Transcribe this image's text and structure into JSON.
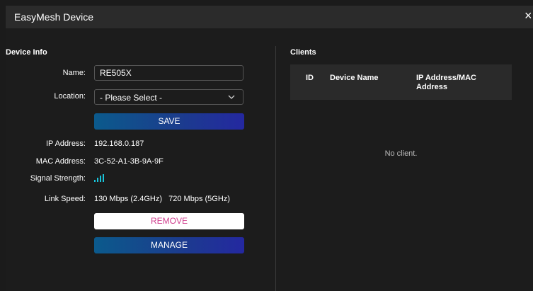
{
  "window": {
    "title": "EasyMesh Device",
    "close_glyph": "×"
  },
  "device_info": {
    "section_title": "Device Info",
    "name_label": "Name:",
    "name_value": "RE505X",
    "location_label": "Location:",
    "location_value": "- Please Select -",
    "save_label": "SAVE",
    "ip_label": "IP Address:",
    "ip_value": "192.168.0.187",
    "mac_label": "MAC Address:",
    "mac_value": "3C-52-A1-3B-9A-9F",
    "signal_label": "Signal Strength:",
    "signal_icon": "signal-bars-icon",
    "signal_bars": 4,
    "link_label": "Link Speed:",
    "link_value": "130 Mbps (2.4GHz)   720 Mbps (5GHz)",
    "remove_label": "REMOVE",
    "manage_label": "MANAGE"
  },
  "clients": {
    "section_title": "Clients",
    "columns": [
      "ID",
      "Device Name",
      "IP Address/MAC Address"
    ],
    "empty_text": "No client."
  },
  "colors": {
    "accent_start": "#0b5a8c",
    "accent_end": "#2428a0",
    "remove_text": "#d03e8e",
    "signal": "#19c3d9"
  }
}
